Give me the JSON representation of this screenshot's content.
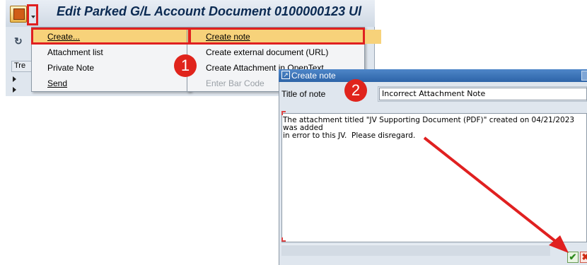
{
  "window": {
    "title": "Edit Parked G/L Account Document 0100000123 Ul"
  },
  "toolbar": {
    "refresh_icon": "refresh-icon",
    "crop_char": "t"
  },
  "tree": {
    "label": "Tre"
  },
  "context_menu": {
    "items": [
      {
        "label": "Create...",
        "has_submenu": true
      },
      {
        "label": "Attachment list",
        "has_submenu": false
      },
      {
        "label": "Private Note",
        "has_submenu": false
      },
      {
        "label": "Send",
        "has_submenu": true
      }
    ]
  },
  "submenu": {
    "items": [
      {
        "label": "Create note",
        "enabled": true
      },
      {
        "label": "Create external document (URL)",
        "enabled": true
      },
      {
        "label": "Create Attachment in OpenText",
        "enabled": true
      },
      {
        "label": "Enter Bar Code",
        "enabled": false
      }
    ]
  },
  "annotations": {
    "step1": "1",
    "step2": "2",
    "highlight_color": "#e02020"
  },
  "dialog": {
    "title": "Create note",
    "title_label": "Title of note",
    "title_value": "Incorrect Attachment Note",
    "body": "The attachment titled \"JV Supporting Document (PDF)\" created on 04/21/2023 was added\nin error to this JV.  Please disregard."
  },
  "colors": {
    "menu_highlight": "#f7d27a",
    "sap_blue": "#2d64a8"
  }
}
